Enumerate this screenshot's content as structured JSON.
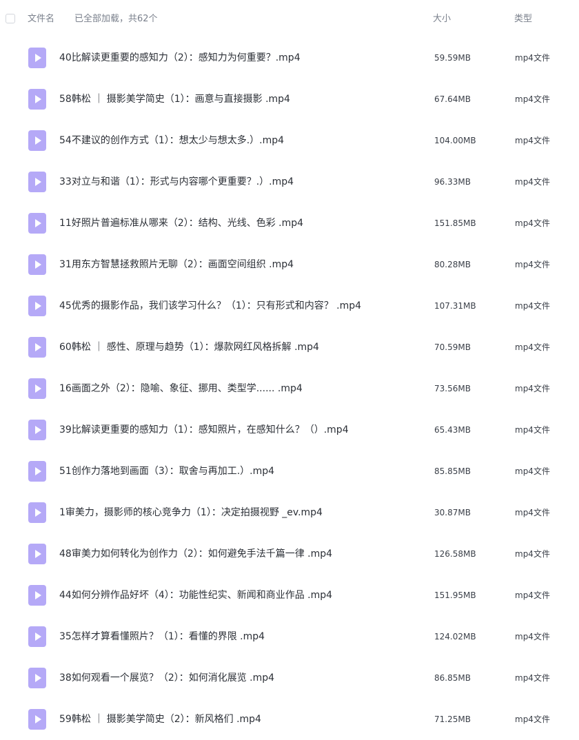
{
  "header": {
    "filename_label": "文件名",
    "load_status": "已全部加载，共62个",
    "size_label": "大小",
    "type_label": "类型"
  },
  "colors": {
    "icon_fill": "#b5a9f7",
    "icon_play": "#ffffff"
  },
  "files": [
    {
      "name": "40比解读更重要的感知力（2）：感知力为何重要？.mp4",
      "size": "59.59MB",
      "type": "mp4文件"
    },
    {
      "name": "58韩松 ｜ 摄影美学简史（1）：画意与直接摄影 .mp4",
      "size": "67.64MB",
      "type": "mp4文件"
    },
    {
      "name": "54不建议的创作方式（1）：想太少与想太多.）.mp4",
      "size": "104.00MB",
      "type": "mp4文件"
    },
    {
      "name": "33对立与和谐（1）：形式与内容哪个更重要？.）.mp4",
      "size": "96.33MB",
      "type": "mp4文件"
    },
    {
      "name": "11好照片普遍标准从哪来（2）：结构、光线、色彩 .mp4",
      "size": "151.85MB",
      "type": "mp4文件"
    },
    {
      "name": "31用东方智慧拯救照片无聊（2）：画面空间组织 .mp4",
      "size": "80.28MB",
      "type": "mp4文件"
    },
    {
      "name": "45优秀的摄影作品，我们该学习什么？（1）：只有形式和内容？ .mp4",
      "size": "107.31MB",
      "type": "mp4文件"
    },
    {
      "name": "60韩松 ｜ 感性、原理与趋势（1）：爆款网红风格拆解 .mp4",
      "size": "70.59MB",
      "type": "mp4文件"
    },
    {
      "name": "16画面之外（2）：隐喻、象征、挪用、类型学...... .mp4",
      "size": "73.56MB",
      "type": "mp4文件"
    },
    {
      "name": "39比解读更重要的感知力（1）：感知照片，在感知什么？（）.mp4",
      "size": "65.43MB",
      "type": "mp4文件"
    },
    {
      "name": "51创作力落地到画面（3）：取舍与再加工.）.mp4",
      "size": "85.85MB",
      "type": "mp4文件"
    },
    {
      "name": "1审美力，摄影师的核心竞争力（1）：决定拍摄视野 _ev.mp4",
      "size": "30.87MB",
      "type": "mp4文件"
    },
    {
      "name": "48审美力如何转化为创作力（2）：如何避免手法千篇一律 .mp4",
      "size": "126.58MB",
      "type": "mp4文件"
    },
    {
      "name": "44如何分辨作品好坏（4）：功能性纪实、新闻和商业作品 .mp4",
      "size": "151.95MB",
      "type": "mp4文件"
    },
    {
      "name": "35怎样才算看懂照片？（1）：看懂的界限 .mp4",
      "size": "124.02MB",
      "type": "mp4文件"
    },
    {
      "name": "38如何观看一个展览？（2）：如何消化展览 .mp4",
      "size": "86.85MB",
      "type": "mp4文件"
    },
    {
      "name": "59韩松 ｜ 摄影美学简史（2）：新风格们 .mp4",
      "size": "71.25MB",
      "type": "mp4文件"
    }
  ]
}
